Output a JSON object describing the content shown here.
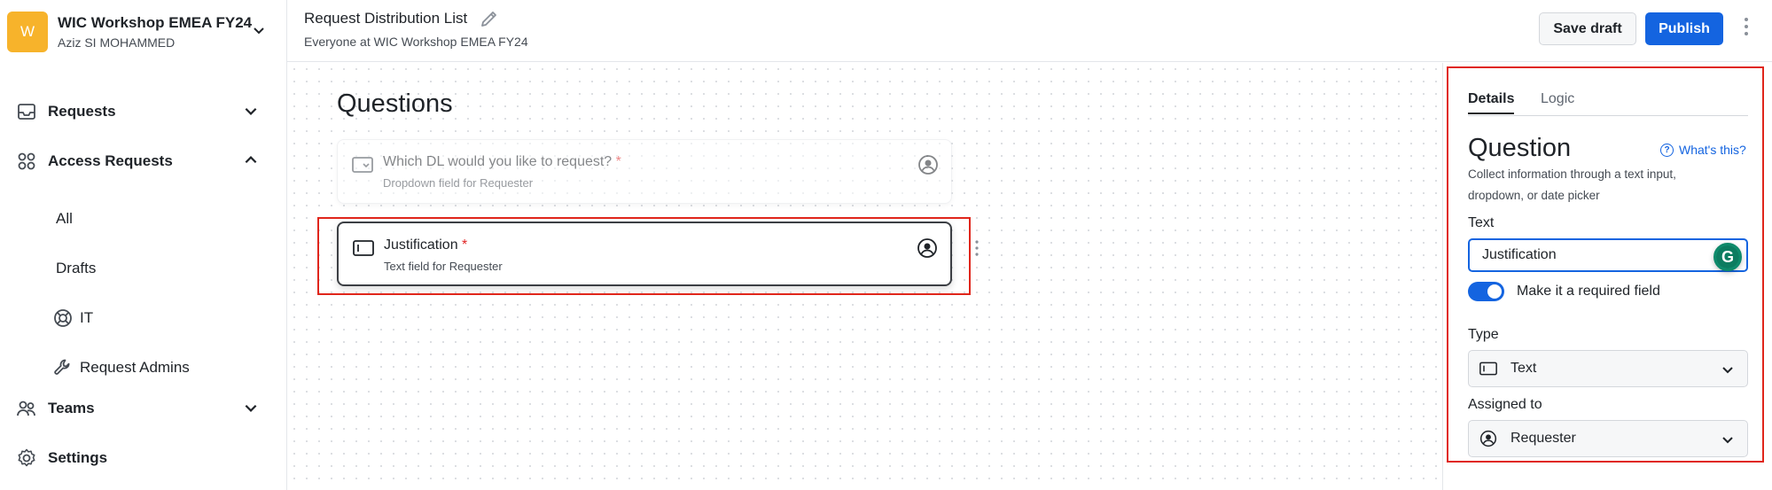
{
  "workspace": {
    "logo_letter": "W",
    "name": "WIC Workshop EMEA FY24",
    "user": "Aziz SI MOHAMMED"
  },
  "sidebar": {
    "requests": "Requests",
    "access_requests": "Access Requests",
    "sub_items": [
      "All",
      "Drafts",
      "IT",
      "Request Admins"
    ],
    "teams": "Teams",
    "settings": "Settings"
  },
  "header": {
    "title": "Request Distribution List",
    "subtitle": "Everyone at WIC Workshop EMEA FY24",
    "save_draft": "Save draft",
    "publish": "Publish"
  },
  "canvas": {
    "section_title": "Questions",
    "questions": [
      {
        "title": "Which DL would you like to request?",
        "required_mark": " *",
        "subtitle": "Dropdown field for Requester"
      },
      {
        "title": "Justification",
        "required_mark": " *",
        "subtitle": "Text field for Requester"
      }
    ]
  },
  "panel": {
    "tabs": [
      "Details",
      "Logic"
    ],
    "heading": "Question",
    "help_link": "What's this?",
    "description": "Collect information through a text input, dropdown, or date picker",
    "text_label": "Text",
    "text_value": "Justification",
    "grammarly_letter": "G",
    "required_toggle_label": "Make it a required field",
    "required_toggle_on": true,
    "type_label": "Type",
    "type_value": "Text",
    "assigned_label": "Assigned to",
    "assigned_value": "Requester"
  },
  "colors": {
    "accent": "#1464e0",
    "logo": "#f7b32b",
    "highlight": "#e0261b",
    "required": "#e02424"
  }
}
